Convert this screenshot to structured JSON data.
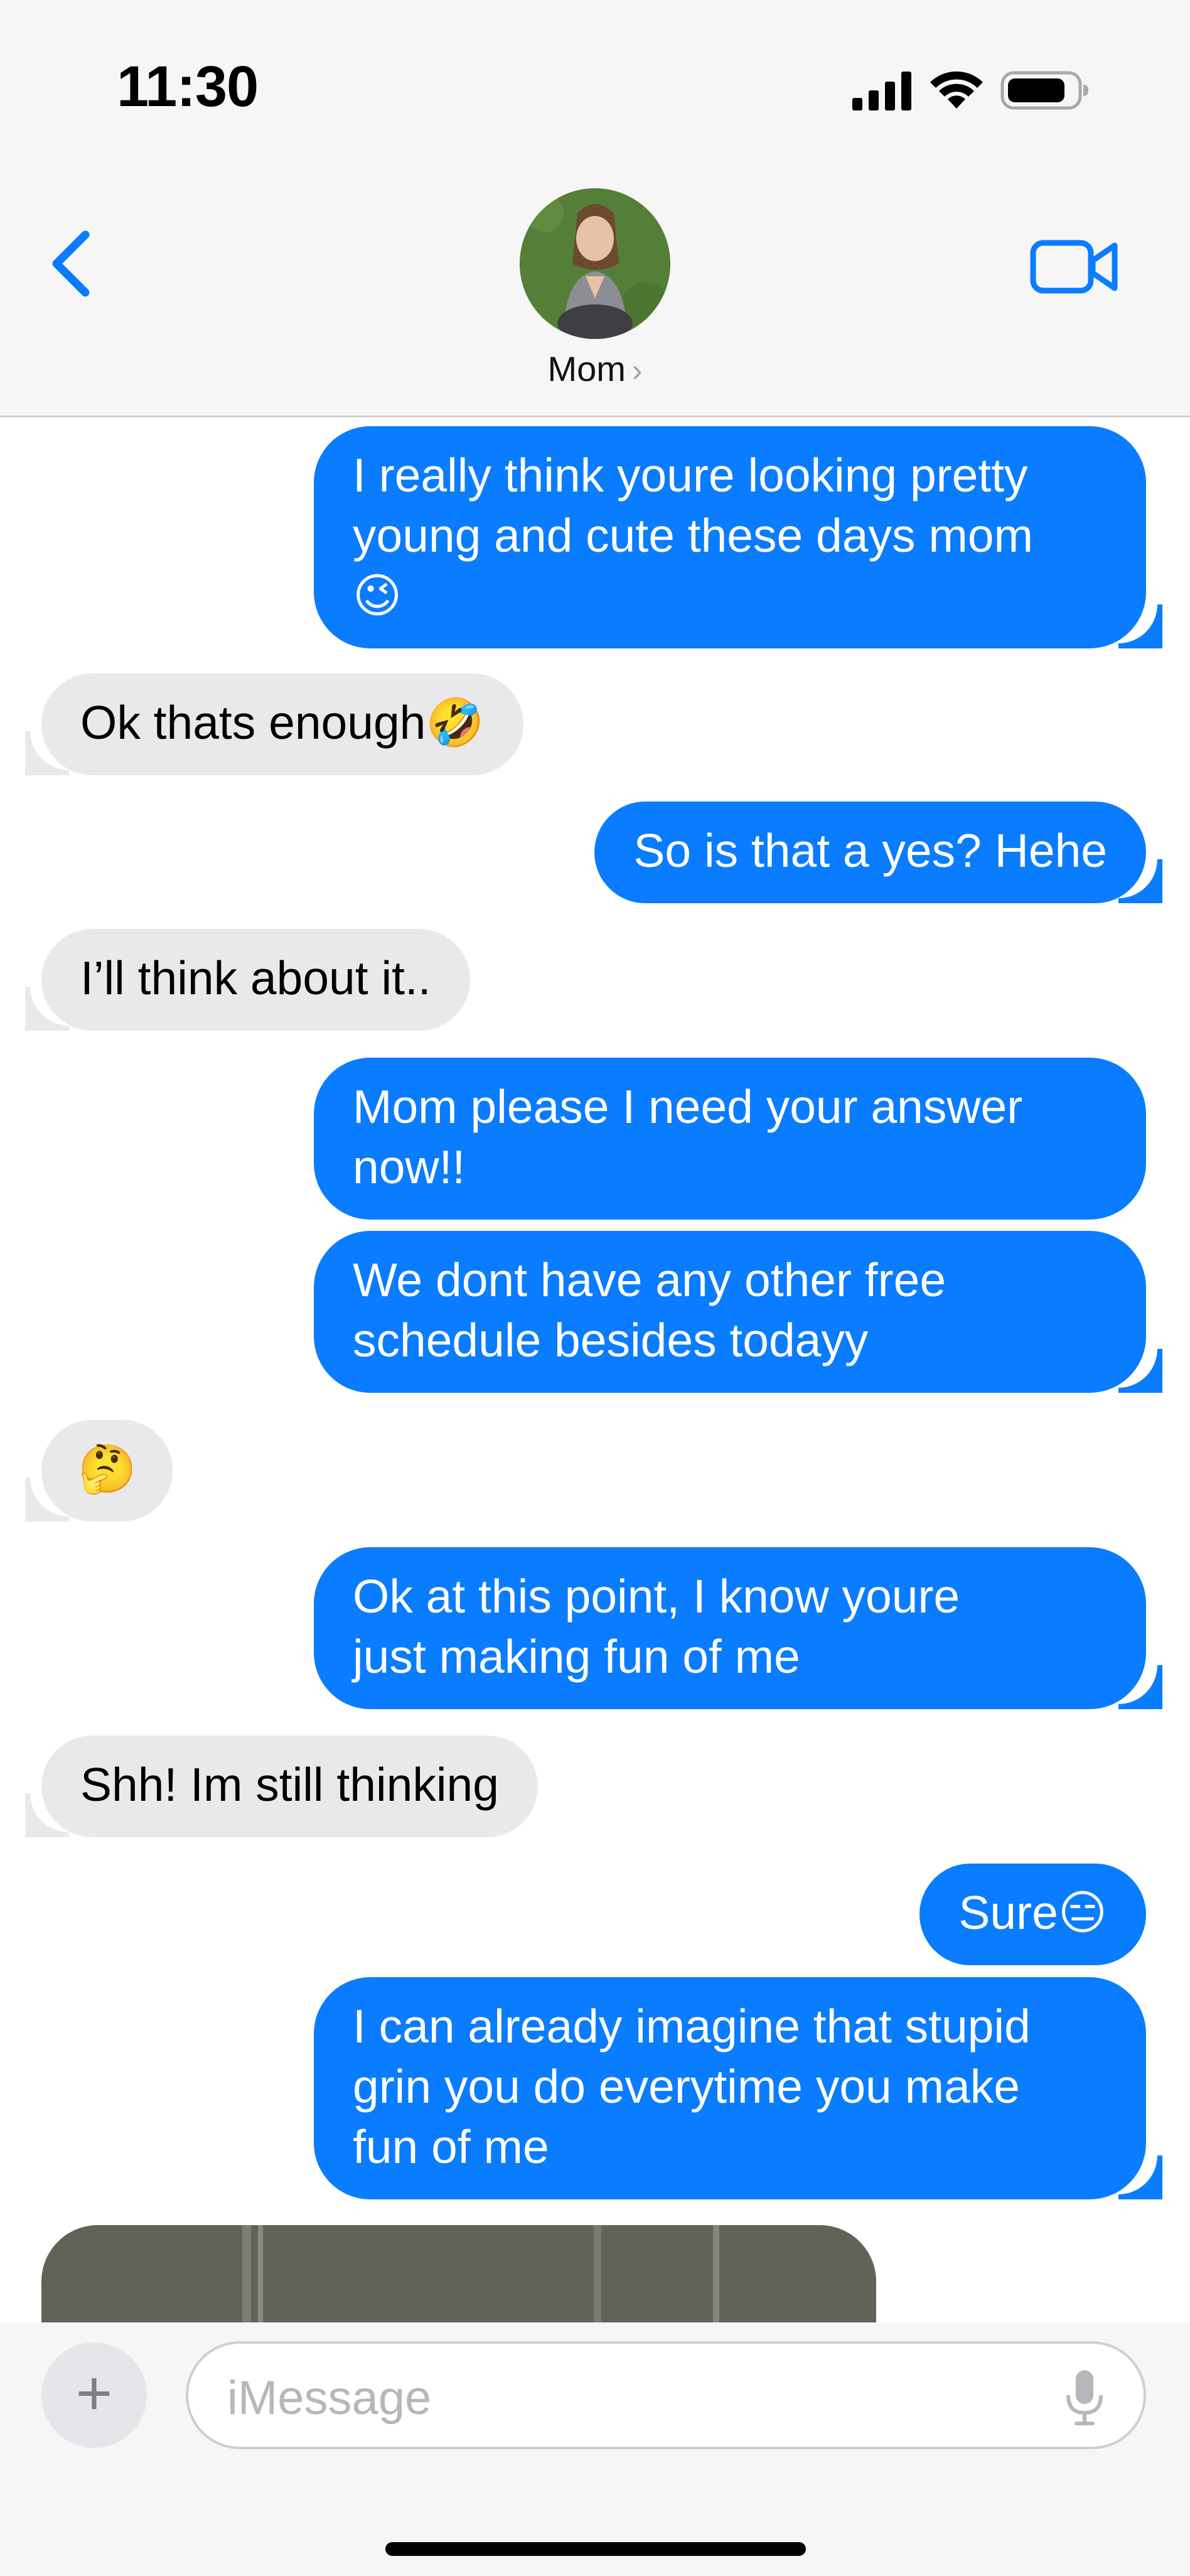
{
  "status_bar": {
    "time": "11:30",
    "icons": [
      "cellular-signal-icon",
      "wifi-icon",
      "battery-icon"
    ]
  },
  "header": {
    "contact_name": "Mom",
    "chevron": "›",
    "back_icon": "chevron-left-icon",
    "video_icon": "video-camera-icon"
  },
  "colors": {
    "outgoing": "#0a7cff",
    "incoming": "#e9e9eb",
    "accent": "#0a7cff"
  },
  "messages": [
    {
      "from": "me",
      "text": "I really think youre looking pretty\nyoung and cute these days mom\n😉"
    },
    {
      "from": "mom",
      "text": "Ok thats enough🤣"
    },
    {
      "from": "me",
      "text": "So is that a yes? Hehe"
    },
    {
      "from": "mom",
      "text": "I’ll think about it.."
    },
    {
      "from": "me",
      "text": "Mom please I need your answer\nnow!!"
    },
    {
      "from": "me",
      "text": "We dont have any other free\nschedule besides todayy"
    },
    {
      "from": "mom",
      "text": "🤔"
    },
    {
      "from": "me",
      "text": "Ok at this point, I know youre\njust making fun of me"
    },
    {
      "from": "mom",
      "text": "Shh! Im still thinking"
    },
    {
      "from": "me",
      "text": "Sure😑"
    },
    {
      "from": "me",
      "text": "I can already imagine that stupid\ngrin you do everytime you make\nfun of me"
    },
    {
      "from": "mom",
      "text": "",
      "type": "photo"
    }
  ],
  "composer": {
    "plus_label": "+",
    "placeholder": "iMessage",
    "mic_icon": "microphone-icon"
  }
}
